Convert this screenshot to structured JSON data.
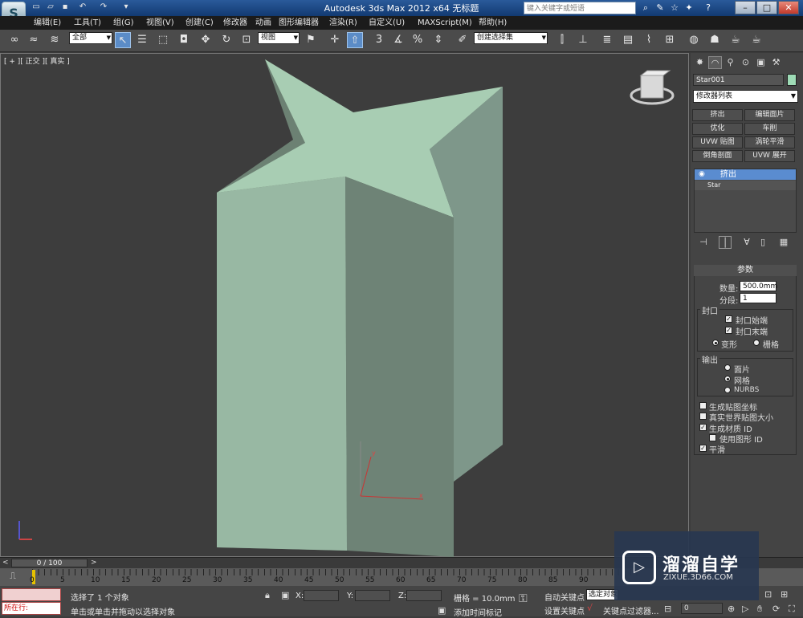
{
  "window": {
    "title": "Autodesk 3ds Max  2012 x64       无标题",
    "search_placeholder": "键入关键字或短语",
    "logo": "S"
  },
  "menu": [
    "编辑(E)",
    "工具(T)",
    "组(G)",
    "视图(V)",
    "创建(C)",
    "修改器",
    "动画",
    "图形编辑器",
    "渲染(R)",
    "自定义(U)",
    "MAXScript(M)",
    "帮助(H)"
  ],
  "toolbar": {
    "selection_filter": "全部",
    "ref_coord": "视图",
    "named_selection": "创建选择集"
  },
  "viewport": {
    "label": "[ + ][ 正交 ][ 真实 ]",
    "object_fill": "#9dbfa9",
    "object_shadow": "#6f8577",
    "axis_x": "x",
    "axis_y": "y"
  },
  "command_panel": {
    "object_name": "Star001",
    "object_color": "#9edbb6",
    "modifier_list": "修改器列表",
    "modifier_buttons": [
      "挤出",
      "编辑面片",
      "优化",
      "车削",
      "UVW 贴图",
      "涡轮平滑",
      "倒角剖面",
      "UVW 展开"
    ],
    "stack": {
      "selected": "挤出",
      "base": "Star"
    },
    "params": {
      "title": "参数",
      "amount_label": "数量:",
      "amount_value": "500.0mm",
      "segments_label": "分段:",
      "segments_value": "1",
      "cap_group": "封口",
      "cap_start": "封口始端",
      "cap_end": "封口末端",
      "morph": "变形",
      "grid": "栅格",
      "output_group": "输出",
      "patch": "面片",
      "mesh": "网格",
      "nurbs": "NURBS",
      "gen_map_coords": "生成贴图坐标",
      "real_world": "真实世界贴图大小",
      "gen_mat_ids": "生成材质 ID",
      "use_shape_ids": "使用图形 ID",
      "smooth": "平滑"
    }
  },
  "timeline": {
    "slider": "0 / 100",
    "ticks": [
      "0",
      "5",
      "10",
      "15",
      "20",
      "25",
      "30",
      "35",
      "40",
      "45",
      "50",
      "55",
      "60",
      "65",
      "70",
      "75",
      "80",
      "85",
      "90"
    ]
  },
  "status": {
    "listener": "所在行:",
    "selected": "选择了 1 个对象",
    "prompt": "单击或单击并拖动以选择对象",
    "x_label": "X:",
    "y_label": "Y:",
    "z_label": "Z:",
    "grid": "栅格 = 10.0mm",
    "auto_key": "自动关键点",
    "set_key": "设置关键点",
    "selected_dd": "选定对象",
    "add_time_tag": "添加时间标记",
    "key_filters": "关键点过滤器...",
    "frame": "0"
  },
  "watermark": {
    "brand": "溜溜自学",
    "url": "ZIXUE.3D66.COM"
  }
}
